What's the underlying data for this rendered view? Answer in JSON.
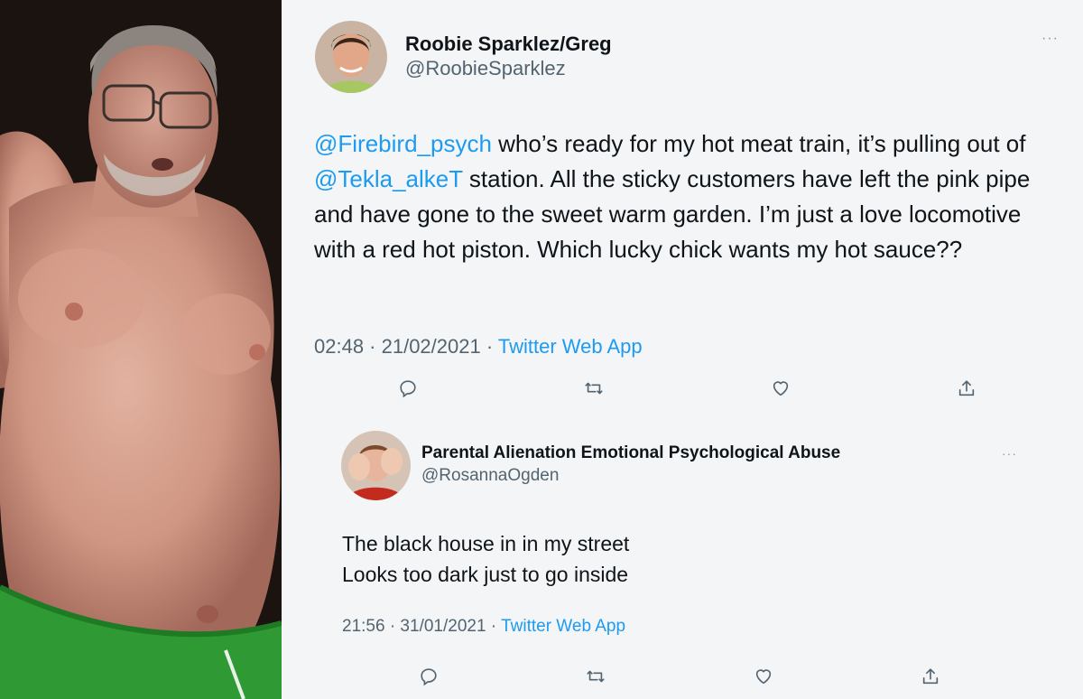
{
  "main_tweet": {
    "display_name": "Roobie Sparklez/Greg",
    "handle": "@RoobieSparklez",
    "more_icon": "more-dots-icon",
    "mention_1": "@Firebird_psych",
    "text_1": " who’s ready for my hot meat train, it’s pulling out of ",
    "mention_2": "@Tekla_alkeT",
    "text_2": " station. All the sticky customers have left the pink pipe and have gone to the sweet warm garden. I’m just a love locomotive with a red hot piston. Which lucky chick wants my hot sauce??",
    "timestamp": "02:48 · 21/02/2021 · ",
    "source": "Twitter Web App",
    "action_icons": [
      "reply-icon",
      "retweet-icon",
      "like-icon",
      "share-icon"
    ]
  },
  "reply_tweet": {
    "display_name": "Parental Alienation Emotional Psychological Abuse",
    "handle": "@RosannaOgden",
    "more_icon": "more-dots-icon",
    "line_1": "The black house in in my street",
    "line_2": "Looks too dark just to go inside",
    "timestamp": "21:56 · 31/01/2021 · ",
    "source": "Twitter Web App",
    "action_icons": [
      "reply-icon",
      "retweet-icon",
      "like-icon",
      "share-icon"
    ]
  },
  "colors": {
    "background": "#f3f5f7",
    "text": "#0f1419",
    "secondary": "#536471",
    "link": "#1d9bf0"
  }
}
